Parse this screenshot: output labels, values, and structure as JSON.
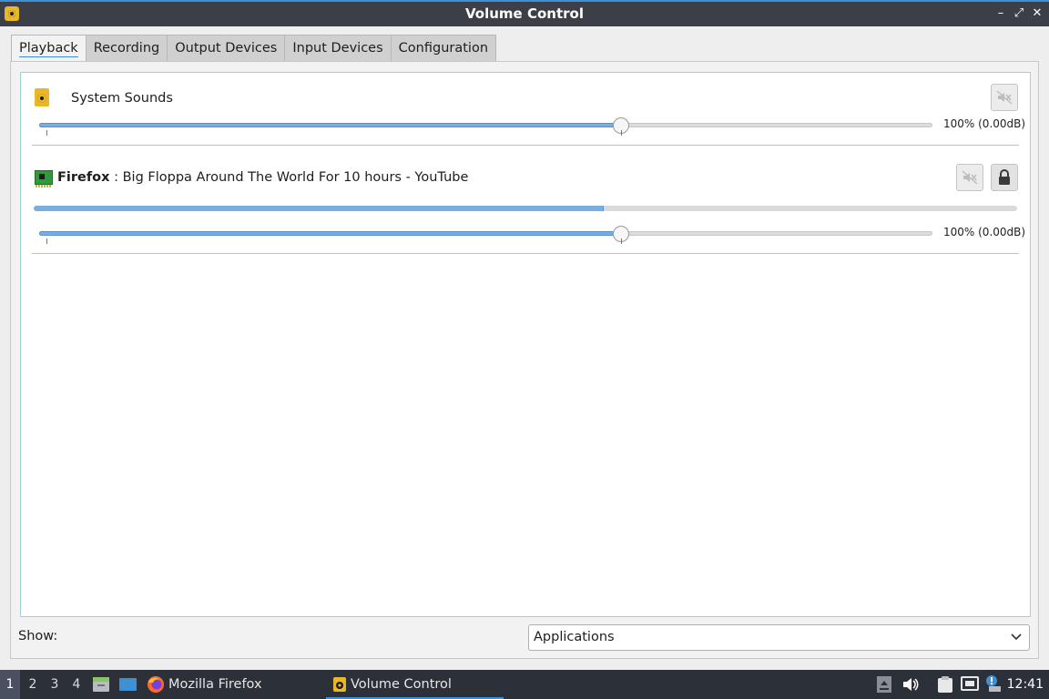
{
  "window": {
    "title": "Volume Control",
    "controls": {
      "minimize": "–",
      "maximize": "⤢",
      "close": "✕"
    }
  },
  "tabs": [
    {
      "label": "Playback",
      "active": true
    },
    {
      "label": "Recording",
      "active": false
    },
    {
      "label": "Output Devices",
      "active": false
    },
    {
      "label": "Input Devices",
      "active": false
    },
    {
      "label": "Configuration",
      "active": false
    }
  ],
  "streams": [
    {
      "app": "",
      "title": "System Sounds",
      "icon": "speaker-icon",
      "volume_percent": 100,
      "volume_label": "100% (0.00dB)"
    },
    {
      "app": "Firefox",
      "title": ": Big Floppa Around The World For 10 hours - YouTube",
      "icon": "sound-card-icon",
      "level_percent": 58,
      "volume_percent": 100,
      "volume_label": "100% (0.00dB)"
    }
  ],
  "footer": {
    "show_label": "Show:",
    "show_value": "Applications"
  },
  "taskbar": {
    "workspaces": [
      "1",
      "2",
      "3",
      "4"
    ],
    "tasks": [
      {
        "label": "Mozilla Firefox",
        "icon": "firefox-icon",
        "active": false
      },
      {
        "label": "Volume Control",
        "icon": "volume-control-icon",
        "active": true
      }
    ],
    "clock": "12:41",
    "accent": "#3d8fd6"
  }
}
